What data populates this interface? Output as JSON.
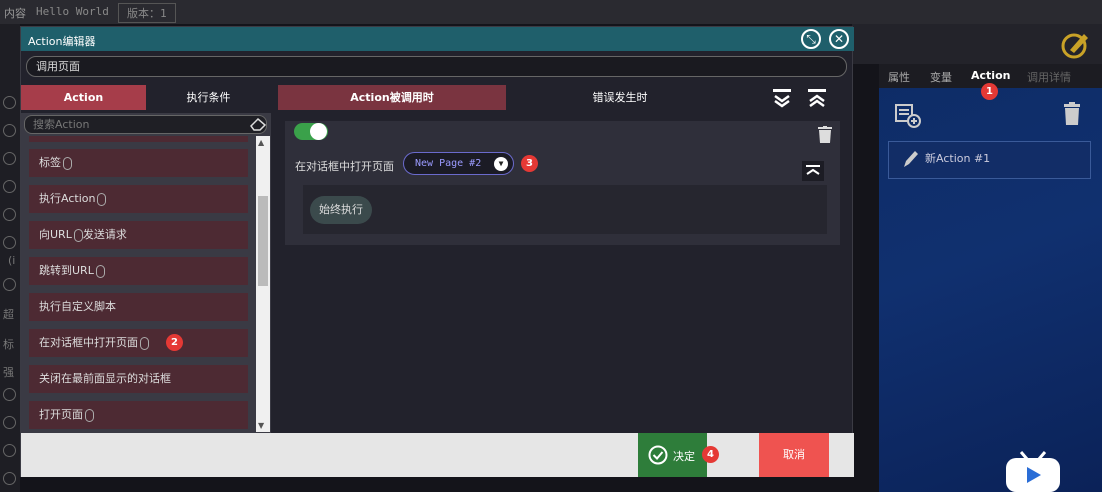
{
  "topbar": {
    "tag": "内容",
    "name": "Hello World",
    "version": "版本：1"
  },
  "background": {
    "left_labels": [
      "(i",
      "超",
      "标",
      "强"
    ]
  },
  "right_panel": {
    "tabs": [
      "属性",
      "变量",
      "Action",
      "调用详情"
    ],
    "active_tab": "Action",
    "items": [
      {
        "label": "新Action #1"
      }
    ]
  },
  "dialog": {
    "title": "Action编辑器",
    "name_value": "调用页面",
    "left_tabs": [
      "Action",
      "执行条件"
    ],
    "trigger_tabs": [
      "Action被调用时",
      "错误发生时"
    ],
    "search_placeholder": "搜索Action",
    "action_items": [
      {
        "label": "标签"
      },
      {
        "label": "执行Action"
      },
      {
        "label": "向URL",
        "suffix": "发送请求"
      },
      {
        "label": "跳转到URL"
      },
      {
        "label": "执行自定义脚本"
      },
      {
        "label": "在对话框中打开页面"
      },
      {
        "label": "关闭在最前面显示的对话框"
      },
      {
        "label": "打开页面"
      }
    ],
    "step": {
      "enabled": true,
      "label": "在对话框中打开页面",
      "page_value": "New Page #2",
      "condition_label": "始终执行"
    },
    "footer": {
      "ok_label": "决定",
      "cancel_label": "取消"
    }
  },
  "callouts": [
    "1",
    "2",
    "3",
    "4"
  ],
  "colors": {
    "title_bar": "#1f5f6b",
    "active_tab": "#a63d4a",
    "toggle_on": "#3aa14a",
    "ok": "#2e7d3a",
    "cancel": "#ef5350",
    "badge": "#e53935"
  }
}
